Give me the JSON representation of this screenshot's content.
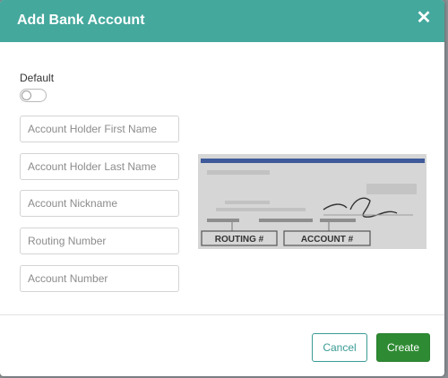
{
  "modal": {
    "title": "Add Bank Account",
    "close_icon": "close-icon"
  },
  "form": {
    "default_label": "Default",
    "default_enabled": false,
    "fields": {
      "first_name": {
        "placeholder": "Account Holder First Name",
        "value": ""
      },
      "last_name": {
        "placeholder": "Account Holder Last Name",
        "value": ""
      },
      "nickname": {
        "placeholder": "Account Nickname",
        "value": ""
      },
      "routing": {
        "placeholder": "Routing Number",
        "value": ""
      },
      "account": {
        "placeholder": "Account Number",
        "value": ""
      }
    }
  },
  "check_illustration": {
    "routing_label": "ROUTING #",
    "account_label": "ACCOUNT #",
    "colors": {
      "stripe": "#3e5a9a",
      "check_bg": "#d9d9d9"
    }
  },
  "footer": {
    "cancel_label": "Cancel",
    "create_label": "Create"
  },
  "theme": {
    "header_color": "#44a89d",
    "create_color": "#2e8b33",
    "cancel_border": "#3a9b94"
  }
}
